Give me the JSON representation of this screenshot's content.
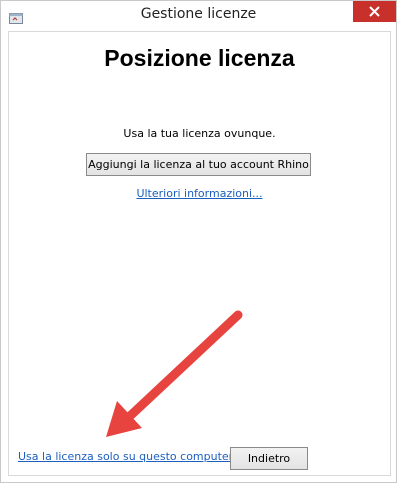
{
  "window": {
    "title": "Gestione licenze"
  },
  "page": {
    "heading": "Posizione licenza",
    "subtext": "Usa la tua licenza ovunque.",
    "add_license_button": "Aggiungi la licenza al tuo account Rhino",
    "more_info_link": "Ulteriori informazioni...",
    "local_license_link": "Usa la licenza solo su questo computer",
    "back_button": "Indietro"
  },
  "colors": {
    "close_button": "#c7302b",
    "link": "#1c5fbf",
    "annotation_arrow": "#e8443f"
  },
  "icons": {
    "app": "license-manager-icon",
    "close": "close-icon",
    "annotation": "red-arrow-annotation"
  }
}
